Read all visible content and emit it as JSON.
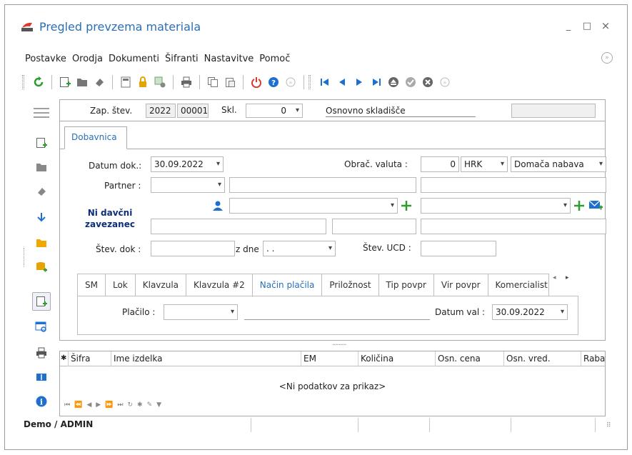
{
  "window": {
    "title": "Pregled prevzema materiala",
    "minimize": "_",
    "maximize": "□",
    "close": "×"
  },
  "menu": [
    {
      "label": "Postavke"
    },
    {
      "label": "Orodja"
    },
    {
      "label": "Dokumenti"
    },
    {
      "label": "Šifranti"
    },
    {
      "label": "Nastavitve"
    },
    {
      "label": "Pomoč"
    }
  ],
  "header": {
    "zap_label": "Zap. štev.",
    "zap_year": "2022",
    "zap_number": "00001",
    "skl_label": "Skl.",
    "skl_value": "0",
    "skl_name": "Osnovno skladišče",
    "extra_value": ""
  },
  "tabs": {
    "main": "Dobavnica"
  },
  "form": {
    "datum_dok_label": "Datum dok.:",
    "datum_dok_value": "30.09.2022",
    "obrac_valuta_label": "Obrač. valuta :",
    "valuta_amount": "0",
    "valuta_code": "HRK",
    "nabava_type": "Domača nabava",
    "partner_label": "Partner :",
    "partner_value": "",
    "ni_davcni_line1": "Ni davčni",
    "ni_davcni_line2": "zavezanec",
    "stev_dok_label": "Štev. dok :",
    "z_dne_label": "z dne",
    "z_dne_value": ". .",
    "stev_ucd_label": "Štev. UCD :"
  },
  "subtabs": [
    {
      "label": "SM"
    },
    {
      "label": "Lok"
    },
    {
      "label": "Klavzula"
    },
    {
      "label": "Klavzula #2"
    },
    {
      "label": "Način plačila"
    },
    {
      "label": "Priložnost"
    },
    {
      "label": "Tip povpr"
    },
    {
      "label": "Vir povpr"
    },
    {
      "label": "Komercialist"
    }
  ],
  "placilo": {
    "placilo_label": "Plačilo :",
    "placilo_value": "",
    "datum_val_label": "Datum val :",
    "datum_val_value": "30.09.2022"
  },
  "grid": {
    "columns": [
      "Šifra",
      "Ime izdelka",
      "EM",
      "Količina",
      "Osn. cena",
      "Osn. vred.",
      "Rabat"
    ],
    "empty_text": "<Ni podatkov za prikaz>"
  },
  "status": {
    "user": "Demo / ADMIN"
  },
  "colors": {
    "accent": "#2a6fb8",
    "green": "#2e9b2e",
    "red": "#d93a2b",
    "blue": "#1f6fd0"
  }
}
